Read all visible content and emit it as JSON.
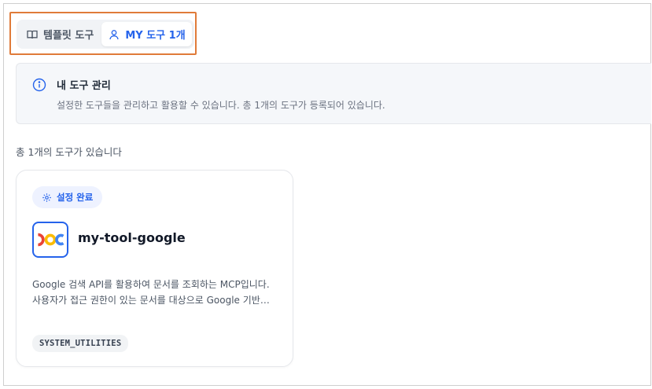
{
  "tabs": [
    {
      "label": "템플릿 도구",
      "icon": "book-icon",
      "active": false
    },
    {
      "label": "MY 도구 1개",
      "icon": "user-icon",
      "active": true
    }
  ],
  "info": {
    "icon": "info-icon",
    "title": "내 도구 관리",
    "description": "설정한 도구들을 관리하고 활용할 수 있습니다. 총 1개의 도구가 등록되어 있습니다."
  },
  "summary": {
    "count_text": "총 1개의 도구가 있습니다"
  },
  "tools": [
    {
      "status_badge": "설정 완료",
      "status_icon": "gear-icon",
      "name": "my-tool-google",
      "logo": "google-docs-logo-icon",
      "description_line1": "Google 검색 API를 활용하여 문서를 조회하는 MCP입니다.",
      "description_line2": "사용자가 접근 권한이 있는 문서를 대상으로 Google 기반…",
      "category": "SYSTEM_UTILITIES"
    }
  ],
  "colors": {
    "accent": "#2563eb",
    "highlight_border": "#e07b39",
    "logo_red": "#ea4335",
    "logo_yellow": "#fbbc05",
    "logo_blue": "#4285f4"
  }
}
